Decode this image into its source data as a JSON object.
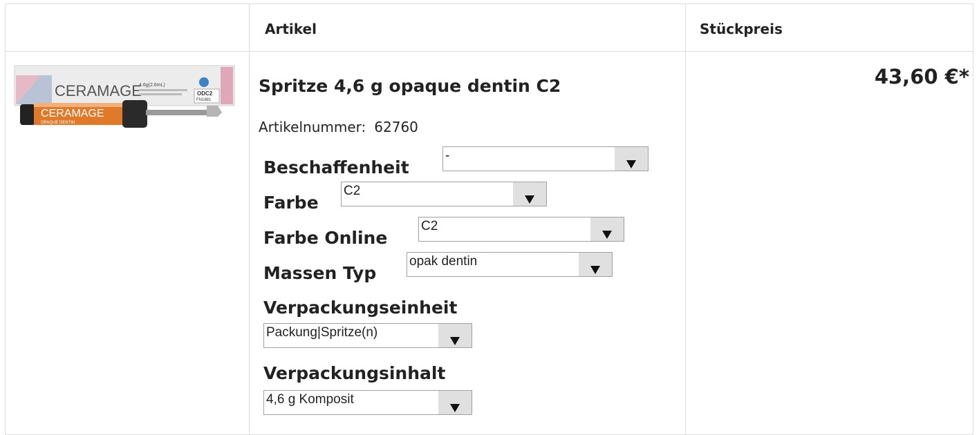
{
  "header": {
    "article_label": "Artikel",
    "price_label": "Stückpreis"
  },
  "product": {
    "image_text_brand": "CERAMAGE",
    "image_text_code": "ODC2",
    "image_text_lot": "FN1881",
    "image_text_sub": "OPAQUE DENTIN",
    "image_text_weight": "4.6g(2.6mL)",
    "title": "Spritze 4,6 g opaque dentin C2",
    "article_number_label": "Artikelnummer:",
    "article_number": "62760",
    "price": "43,60 €*"
  },
  "options": [
    {
      "label": "Beschaffenheit",
      "value": "-"
    },
    {
      "label": "Farbe",
      "value": "C2"
    },
    {
      "label": "Farbe Online",
      "value": "C2"
    },
    {
      "label": "Massen Typ",
      "value": "opak dentin"
    },
    {
      "label": "Verpackungseinheit",
      "value": "Packung|Spritze(n)"
    },
    {
      "label": "Verpackungsinhalt",
      "value": "4,6 g Komposit"
    }
  ]
}
